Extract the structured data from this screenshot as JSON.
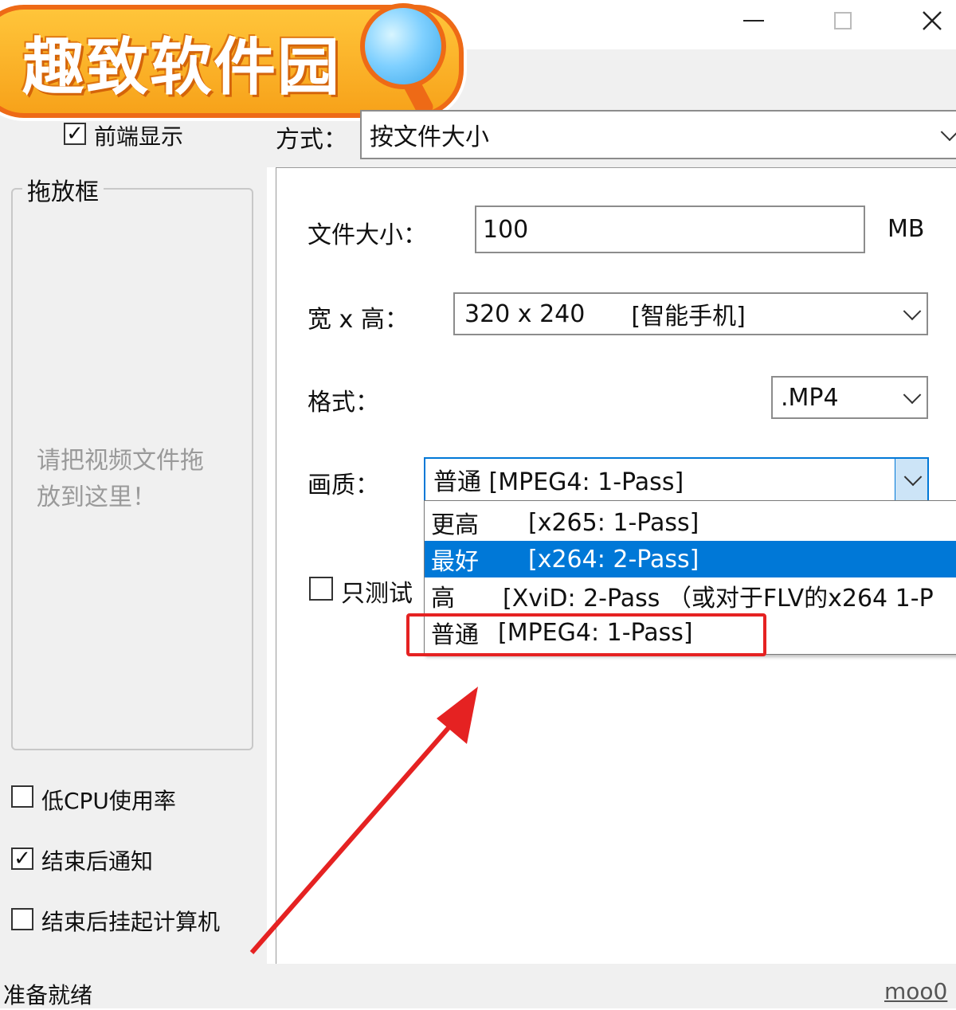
{
  "window": {
    "minimize_icon": "minimize-icon",
    "maximize_icon": "maximize-icon",
    "close_icon": "close-icon"
  },
  "logo": {
    "text": "趣致软件园"
  },
  "left": {
    "front_display_label": "前端显示",
    "front_display_checked": true,
    "drop_box_title": "拖放框",
    "drop_hint_line1": "请把视频文件拖",
    "drop_hint_line2": "放到这里！",
    "low_cpu_label": "低CPU使用率",
    "low_cpu_checked": false,
    "notify_label": "结束后通知",
    "notify_checked": true,
    "suspend_label": "结束后挂起计算机",
    "suspend_checked": false
  },
  "mode": {
    "label": "方式：",
    "value": "按文件大小"
  },
  "settings": {
    "file_size_label": "文件大小：",
    "file_size_value": "100",
    "file_size_unit": "MB",
    "resolution_label": "宽 x 高：",
    "resolution_value": "320 x 240",
    "resolution_device": "[智能手机]",
    "format_label": "格式：",
    "format_value": ".MP4",
    "quality_label": "画质：",
    "quality_value": "普通  [MPEG4: 1-Pass]",
    "test_only_label": "只测试",
    "test_only_checked": false
  },
  "quality_options": [
    {
      "name": "更高",
      "codec": "[x265: 1-Pass]"
    },
    {
      "name": "最好",
      "codec": "[x264: 2-Pass]"
    },
    {
      "name": "高",
      "codec": "[XviD: 2-Pass  （或对于FLV的x264 1-P"
    },
    {
      "name": "普通",
      "codec": "[MPEG4: 1-Pass]"
    }
  ],
  "selected_option_index": 1,
  "status": {
    "text": "准备就绪",
    "link": "moo0"
  },
  "colors": {
    "selection": "#0078d7",
    "annotation": "#e52222",
    "logo_orange": "#ee6a16"
  }
}
